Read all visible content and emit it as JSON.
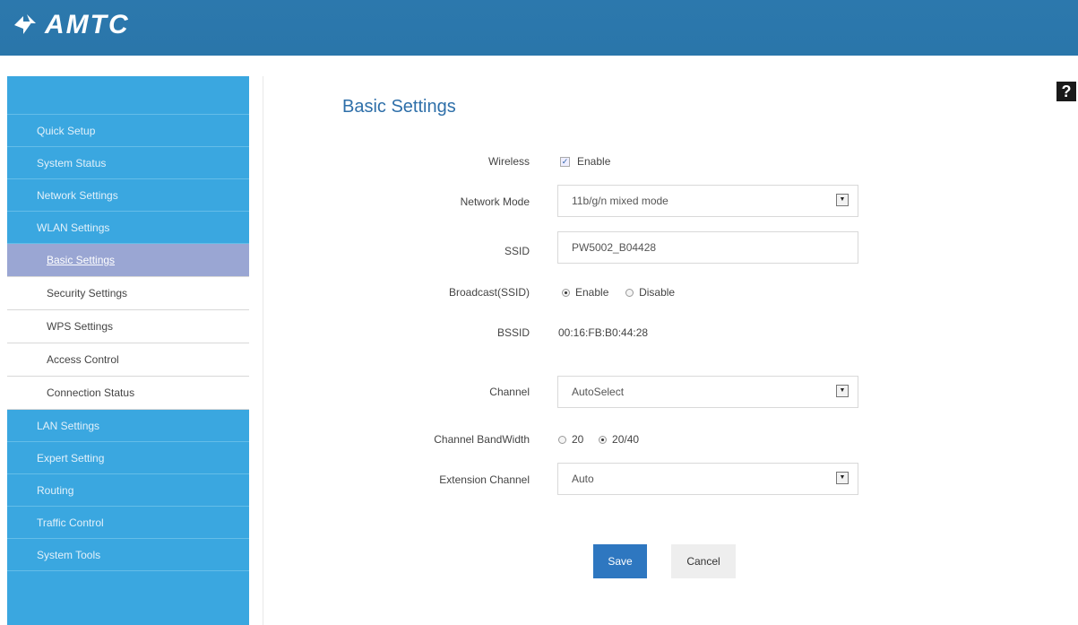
{
  "brand": {
    "name": "AMTC"
  },
  "help": {
    "label": "?"
  },
  "sidebar": {
    "items": [
      {
        "label": "Quick Setup"
      },
      {
        "label": "System Status"
      },
      {
        "label": "Network Settings"
      },
      {
        "label": "WLAN Settings"
      }
    ],
    "sub_items": [
      {
        "label": "Basic Settings"
      },
      {
        "label": "Security Settings"
      },
      {
        "label": "WPS Settings"
      },
      {
        "label": "Access Control"
      },
      {
        "label": "Connection Status"
      }
    ],
    "items_after": [
      {
        "label": "LAN Settings"
      },
      {
        "label": "Expert Setting"
      },
      {
        "label": "Routing"
      },
      {
        "label": "Traffic Control"
      },
      {
        "label": "System Tools"
      }
    ]
  },
  "main": {
    "title": "Basic Settings",
    "wireless": {
      "label": "Wireless",
      "value": "Enable"
    },
    "network_mode": {
      "label": "Network Mode",
      "value": "11b/g/n mixed mode"
    },
    "ssid": {
      "label": "SSID",
      "value": "PW5002_B04428"
    },
    "broadcast": {
      "label": "Broadcast(SSID)",
      "enable": "Enable",
      "disable": "Disable"
    },
    "bssid": {
      "label": "BSSID",
      "value": "00:16:FB:B0:44:28"
    },
    "channel": {
      "label": "Channel",
      "value": "AutoSelect"
    },
    "bandwidth": {
      "label": "Channel BandWidth",
      "opt1": "20",
      "opt2": "20/40"
    },
    "extension": {
      "label": "Extension Channel",
      "value": "Auto"
    },
    "save_label": "Save",
    "cancel_label": "Cancel"
  },
  "colors": {
    "header": "#2a76aa",
    "sidebar": "#3aa7e0",
    "accent": "#2e77c0",
    "title": "#2e6fa9"
  }
}
